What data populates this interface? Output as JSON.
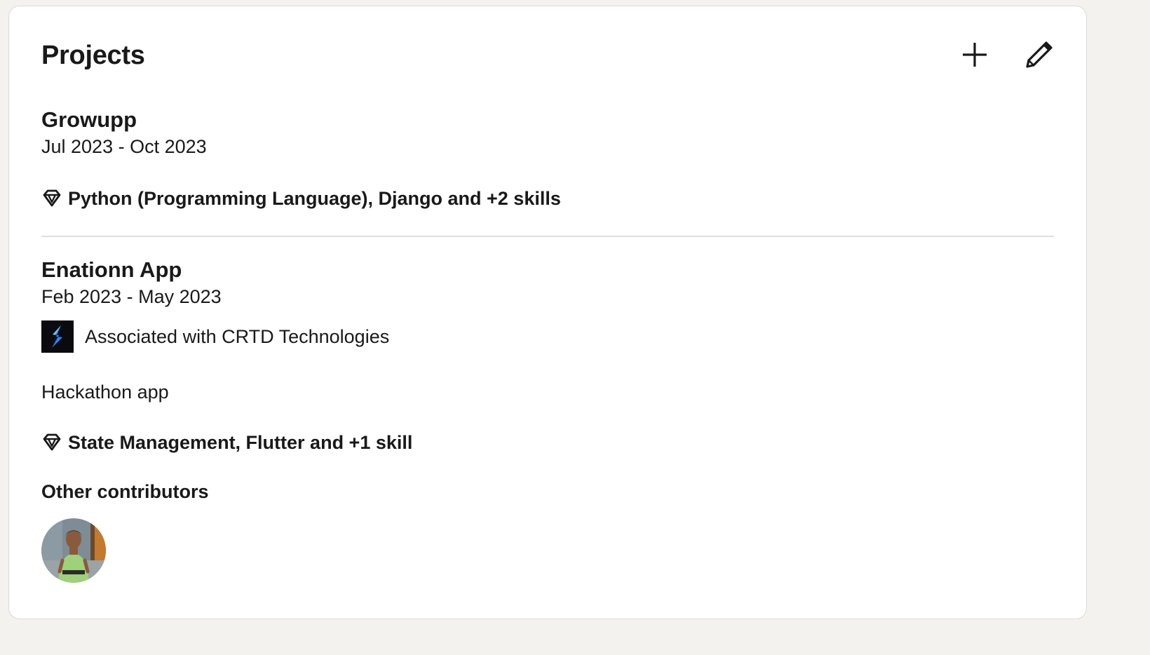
{
  "section": {
    "title": "Projects"
  },
  "icons": {
    "add": "plus-icon",
    "edit": "pencil-icon",
    "skills": "diamond-icon"
  },
  "projects": [
    {
      "title": "Growupp",
      "dates": "Jul 2023 - Oct 2023",
      "skills": "Python (Programming Language), Django and +2 skills"
    },
    {
      "title": "Enationn App",
      "dates": "Feb 2023 - May 2023",
      "association": "Associated with CRTD Technologies",
      "description": "Hackathon app",
      "skills": "State Management, Flutter and +1 skill",
      "contributors_label": "Other contributors"
    }
  ],
  "colors": {
    "page_background": "#f4f2ee",
    "card_background": "#ffffff",
    "text_primary": "#191919",
    "divider": "#e0dfdc",
    "logo_background": "#0b0b0f",
    "logo_accent": "#1e8bff"
  }
}
